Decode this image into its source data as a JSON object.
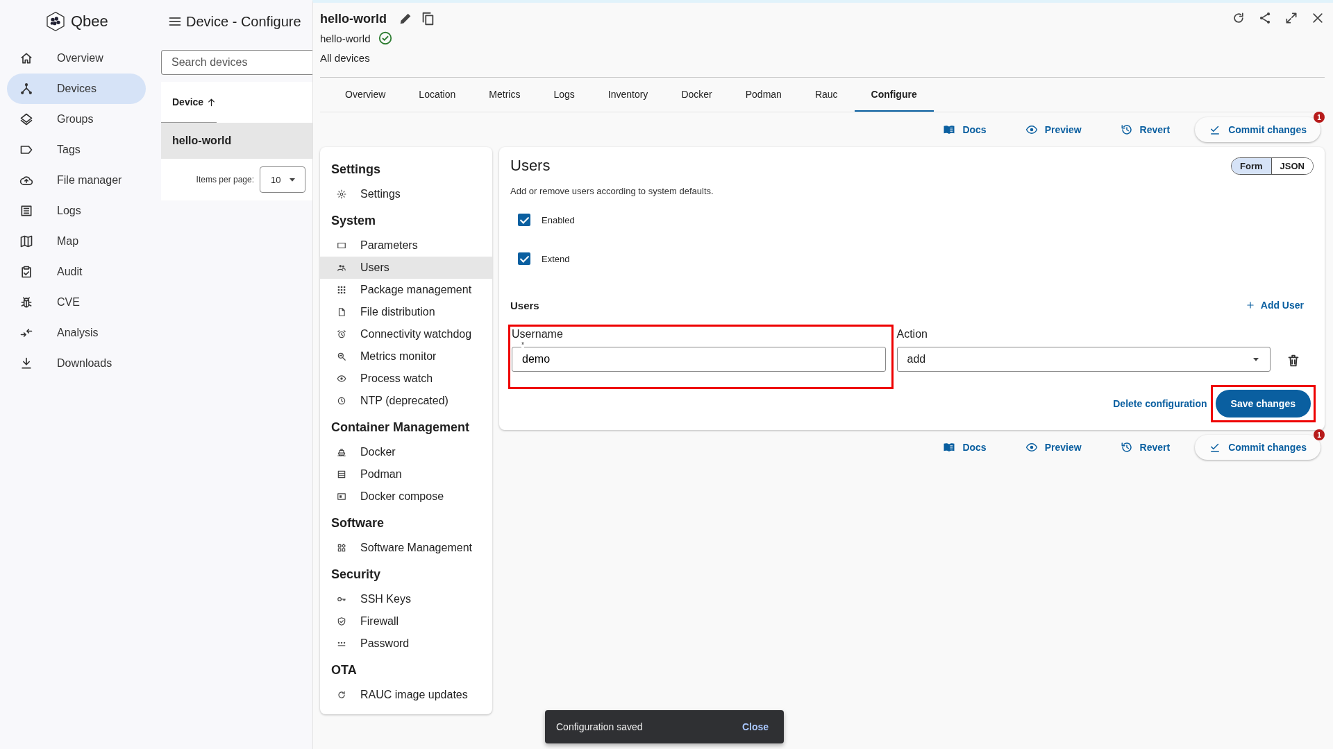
{
  "app": {
    "logo": "Qbee"
  },
  "nav": [
    {
      "label": "Overview",
      "selected": false
    },
    {
      "label": "Devices",
      "selected": true
    },
    {
      "label": "Groups",
      "selected": false
    },
    {
      "label": "Tags",
      "selected": false
    },
    {
      "label": "File manager",
      "selected": false
    },
    {
      "label": "Logs",
      "selected": false
    },
    {
      "label": "Map",
      "selected": false
    },
    {
      "label": "Audit",
      "selected": false
    },
    {
      "label": "CVE",
      "selected": false
    },
    {
      "label": "Analysis",
      "selected": false
    },
    {
      "label": "Downloads",
      "selected": false
    }
  ],
  "device_list": {
    "title": "Device - Configure",
    "search": {
      "placeholder": "Search devices"
    },
    "column": "Device",
    "rows": [
      {
        "name": "hello-world",
        "selected": true
      }
    ],
    "items_per_page_label": "Items per page:",
    "items_per_page": "10"
  },
  "device": {
    "title": "hello-world",
    "subtitle": "hello-world",
    "online": true,
    "breadcrumb": "All devices"
  },
  "tabs": [
    {
      "label": "Overview",
      "selected": false
    },
    {
      "label": "Location",
      "selected": false
    },
    {
      "label": "Metrics",
      "selected": false
    },
    {
      "label": "Logs",
      "selected": false
    },
    {
      "label": "Inventory",
      "selected": false
    },
    {
      "label": "Docker",
      "selected": false
    },
    {
      "label": "Podman",
      "selected": false
    },
    {
      "label": "Rauc",
      "selected": false
    },
    {
      "label": "Configure",
      "selected": true
    }
  ],
  "actions_top": [
    {
      "kind": "docs",
      "label": "Docs"
    },
    {
      "kind": "preview",
      "label": "Preview"
    },
    {
      "kind": "revert",
      "label": "Revert"
    },
    {
      "kind": "commit",
      "label": "Commit changes",
      "badge": "1"
    }
  ],
  "config_nav": [
    {
      "heading": "Settings",
      "items": [
        {
          "label": "Settings",
          "selected": false
        }
      ]
    },
    {
      "heading": "System",
      "items": [
        {
          "label": "Parameters",
          "selected": false
        },
        {
          "label": "Users",
          "selected": true
        },
        {
          "label": "Package management",
          "selected": false
        },
        {
          "label": "File distribution",
          "selected": false
        },
        {
          "label": "Connectivity watchdog",
          "selected": false
        },
        {
          "label": "Metrics monitor",
          "selected": false
        },
        {
          "label": "Process watch",
          "selected": false
        },
        {
          "label": "NTP (deprecated)",
          "selected": false
        }
      ]
    },
    {
      "heading": "Container Management",
      "items": [
        {
          "label": "Docker",
          "selected": false
        },
        {
          "label": "Podman",
          "selected": false
        },
        {
          "label": "Docker compose",
          "selected": false
        }
      ]
    },
    {
      "heading": "Software",
      "items": [
        {
          "label": "Software Management",
          "selected": false
        }
      ]
    },
    {
      "heading": "Security",
      "items": [
        {
          "label": "SSH Keys",
          "selected": false
        },
        {
          "label": "Firewall",
          "selected": false
        },
        {
          "label": "Password",
          "selected": false
        }
      ]
    },
    {
      "heading": "OTA",
      "items": [
        {
          "label": "RAUC image updates",
          "selected": false
        }
      ]
    }
  ],
  "panel": {
    "title": "Users",
    "view_toggle": [
      {
        "label": "Form",
        "selected": true
      },
      {
        "label": "JSON",
        "selected": false
      }
    ],
    "description": "Add or remove users according to system defaults.",
    "checkboxes": [
      {
        "label": "Enabled",
        "checked": true
      },
      {
        "label": "Extend",
        "checked": true
      }
    ],
    "users_heading": "Users",
    "add_label": "Add User",
    "users": [
      {
        "username_label": "Username",
        "required_mark": "*",
        "username": "demo",
        "action_label": "Action",
        "action": "add",
        "highlighted": true
      }
    ],
    "delete_label": "Delete configuration",
    "save": {
      "label": "Save changes",
      "highlighted": true
    }
  },
  "actions_bottom": [
    {
      "kind": "docs",
      "label": "Docs"
    },
    {
      "kind": "preview",
      "label": "Preview"
    },
    {
      "kind": "revert",
      "label": "Revert"
    },
    {
      "kind": "commit",
      "label": "Commit changes",
      "badge": "1"
    }
  ],
  "snackbar": {
    "message": "Configuration saved",
    "action": "Close"
  }
}
